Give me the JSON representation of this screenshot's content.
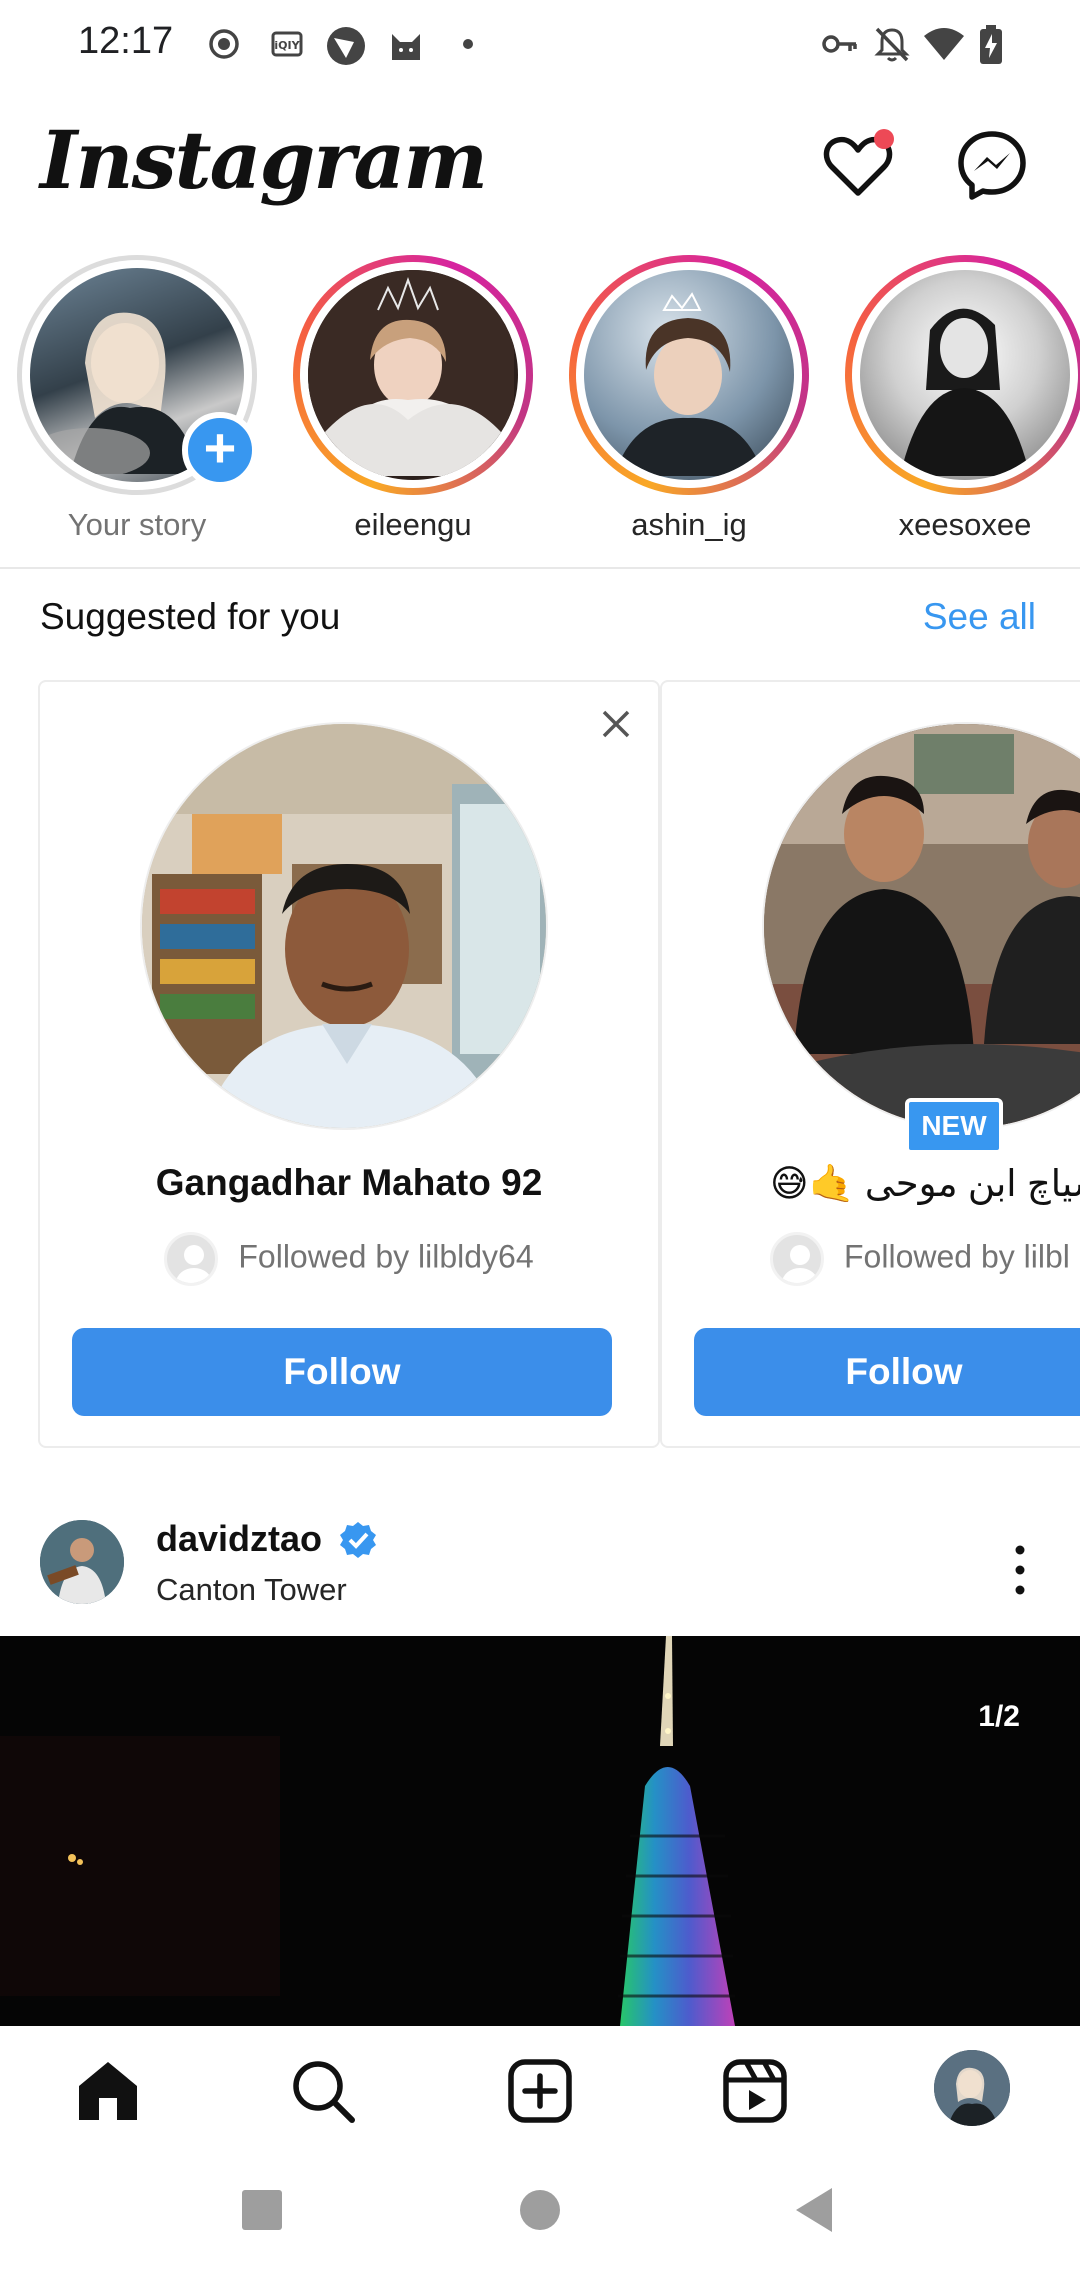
{
  "status_bar": {
    "time": "12:17",
    "icons": [
      "record-icon",
      "iqiyi-icon",
      "browser-icon",
      "cat-icon",
      "dot-icon",
      "vpn-key-icon",
      "notifications-off-icon",
      "wifi-icon",
      "battery-charging-icon"
    ]
  },
  "header": {
    "logo": "Instagram",
    "icons": [
      "heart-icon",
      "messenger-icon"
    ],
    "notification_dot_color": "#ed4956"
  },
  "stories": [
    {
      "name": "Your story",
      "own": true
    },
    {
      "name": "eileengu",
      "own": false
    },
    {
      "name": "ashin_ig",
      "own": false
    },
    {
      "name": "xeesoxee",
      "own": false
    }
  ],
  "suggested": {
    "title": "Suggested for you",
    "see_all": "See all",
    "cards": [
      {
        "name": "Gangadhar Mahato 92",
        "followed_by": "Followed by lilbldy64",
        "button": "Follow"
      },
      {
        "name": "شیاچ ابن موحی 🤙😅",
        "followed_by": "Followed by lilbl",
        "button": "Follow",
        "badge": "NEW"
      }
    ]
  },
  "post": {
    "username": "davidztao",
    "location": "Canton Tower",
    "page_counter": "1/2"
  },
  "bottom_nav": [
    "home-icon",
    "search-icon",
    "create-icon",
    "reels-icon",
    "profile-avatar"
  ],
  "system_nav": [
    "recents-button",
    "home-button",
    "back-button"
  ],
  "colors": {
    "accent": "#3897f0",
    "follow_button": "#3b8eea",
    "text": "#262626",
    "muted": "#737373"
  }
}
